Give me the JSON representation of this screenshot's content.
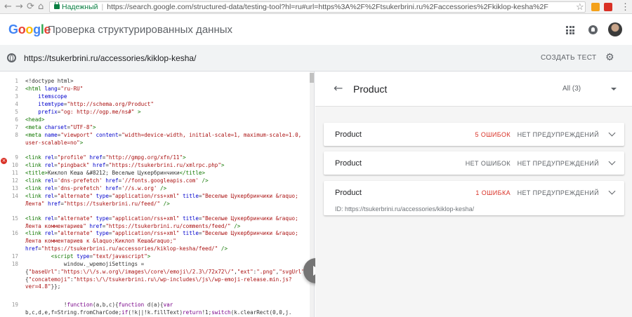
{
  "browser": {
    "back": "←",
    "forward": "→",
    "reload": "⟳",
    "home": "⌂",
    "secure_label": "Надежный",
    "url": "https://search.google.com/structured-data/testing-tool?hl=ru#url=https%3A%2F%2Ftsukerbrini.ru%2Faccessories%2Fkiklop-kesha%2F",
    "star": "☆",
    "menu": "⋮"
  },
  "app": {
    "logo_letters": [
      "G",
      "o",
      "o",
      "g",
      "l",
      "e"
    ],
    "logo_colors": [
      "#4285f4",
      "#ea4335",
      "#fbbc05",
      "#4285f4",
      "#34a853",
      "#ea4335"
    ],
    "title": "Проверка структурированных данных"
  },
  "urlbar": {
    "tested_url": "https://tsukerbrini.ru/accessories/kiklop-kesha/",
    "create_test": "СОЗДАТЬ ТЕСТ",
    "settings_glyph": "⚙"
  },
  "code": {
    "error_glyph": "×",
    "lines": [
      {
        "n": "1",
        "html": "&lt;!doctype html&gt;"
      },
      {
        "n": "2",
        "html": "<span class='t'>&lt;html</span> <span class='a'>lang</span>=<span class='s'>\"ru-RU\"</span>"
      },
      {
        "n": "3",
        "html": "    <span class='a'>itemscope</span>"
      },
      {
        "n": "4",
        "html": "    <span class='a'>itemtype</span>=<span class='s'>\"http://schema.org/Product\"</span>"
      },
      {
        "n": "5",
        "html": "    <span class='a'>prefix</span>=<span class='s'>\"og: http://ogp.me/ns#\"</span> <span class='t'>&gt;</span>"
      },
      {
        "n": "6",
        "html": "<span class='t'>&lt;head&gt;</span>"
      },
      {
        "n": "7",
        "html": "<span class='t'>&lt;meta</span> <span class='a'>charset</span>=<span class='s'>\"UTF-8\"</span><span class='t'>&gt;</span>"
      },
      {
        "n": "8",
        "html": "<span class='t'>&lt;meta</span> <span class='a'>name</span>=<span class='s'>\"viewport\"</span> <span class='a'>content</span>=<span class='s'>\"width=device-width, initial-scale=1, maximum-scale=1.0, user-scalable=no\"</span><span class='t'>&gt;</span>"
      },
      {
        "n": "9",
        "html": "<span class='t'>&lt;link</span> <span class='a'>rel</span>=<span class='s'>\"profile\"</span> <span class='a'>href</span>=<span class='s'>\"http://gmpg.org/xfn/11\"</span><span class='t'>&gt;</span>"
      },
      {
        "n": "10",
        "html": "<span class='t'>&lt;link</span> <span class='a'>rel</span>=<span class='s'>\"pingback\"</span> <span class='a'>href</span>=<span class='s'>\"https://tsukerbrini.ru/xmlrpc.php\"</span><span class='t'>&gt;</span>"
      },
      {
        "n": "11",
        "html": "<span class='t'>&lt;title&gt;</span>Киклоп Кеша &amp;#8212; Веселые Цукербринчики<span class='t'>&lt;/title&gt;</span>"
      },
      {
        "n": "12",
        "html": "<span class='t'>&lt;link</span> <span class='a'>rel</span>=<span class='s'>'dns-prefetch'</span> <span class='a'>href</span>=<span class='s'>'//fonts.googleapis.com'</span> <span class='t'>/&gt;</span>"
      },
      {
        "n": "13",
        "html": "<span class='t'>&lt;link</span> <span class='a'>rel</span>=<span class='s'>'dns-prefetch'</span> <span class='a'>href</span>=<span class='s'>'//s.w.org'</span> <span class='t'>/&gt;</span>"
      },
      {
        "n": "14",
        "html": "<span class='t'>&lt;link</span> <span class='a'>rel</span>=<span class='s'>\"alternate\"</span> <span class='a'>type</span>=<span class='s'>\"application/rss+xml\"</span> <span class='a'>title</span>=<span class='s'>\"Веселые Цукербринчики &amp;raquo; Лента\"</span> <span class='a'>href</span>=<span class='s'>\"https://tsukerbrini.ru/feed/\"</span> <span class='t'>/&gt;</span>"
      },
      {
        "n": "15",
        "html": "<span class='t'>&lt;link</span> <span class='a'>rel</span>=<span class='s'>\"alternate\"</span> <span class='a'>type</span>=<span class='s'>\"application/rss+xml\"</span> <span class='a'>title</span>=<span class='s'>\"Веселые Цукербринчики &amp;raquo; Лента комментариев\"</span> <span class='a'>href</span>=<span class='s'>\"https://tsukerbrini.ru/comments/feed/\"</span> <span class='t'>/&gt;</span>"
      },
      {
        "n": "16",
        "html": "<span class='t'>&lt;link</span> <span class='a'>rel</span>=<span class='s'>\"alternate\"</span> <span class='a'>type</span>=<span class='s'>\"application/rss+xml\"</span> <span class='a'>title</span>=<span class='s'>\"Веселые Цукербринчики &amp;raquo; Лента комментариев к &amp;laquo;Киклоп Кеша&amp;raquo;\"</span> <span class='a'>href</span>=<span class='s'>\"https://tsukerbrini.ru/accessories/kiklop-kesha/feed/\"</span> <span class='t'>/&gt;</span>"
      },
      {
        "n": "17",
        "html": "        <span class='t'>&lt;script</span> <span class='a'>type</span>=<span class='s'>\"text/javascript\"</span><span class='t'>&gt;</span>"
      },
      {
        "n": "18",
        "html": "            window._wpemojiSettings = {<span class='s'>\"baseUrl\"</span>:<span class='s'>\"https:\\/\\/s.w.org\\/images\\/core\\/emoji\\/2.3\\/72x72\\/\"</span>,<span class='s'>\"ext\"</span>:<span class='s'>\".png\"</span>,<span class='s'>\"svgUrl\"</span>:<span class='s'>\"https:\\/\\/s.w.org\\/images\\/core\\/emoji\\/2.3\\/svg\\/\"</span>,<span class='s'>\"svgExt\"</span>:<span class='s'>\".svg\"</span>,<span class='s'>\"source\"</span>:{<span class='s'>\"concatemoji\"</span>:<span class='s'>\"https:\\/\\/tsukerbrini.ru\\/wp-includes\\/js\\/wp-emoji-release.min.js?ver=4.8\"</span>}};"
      },
      {
        "n": "19",
        "html": "            !<span class='k'>function</span>(a,b,c){<span class='k'>function</span> d(a){<span class='k'>var</span> b,c,d,e,f=String.fromCharCode;<span class='k'>if</span>(!k||!k.fillText)<span class='k'>return</span>!1;<span class='k'>switch</span>(k.clearRect(0,0,j.</span>"
      }
    ]
  },
  "results": {
    "back_glyph": "←",
    "title": "Product",
    "filter": "All (3)",
    "cards": [
      {
        "name": "Product",
        "errors": "5 ОШИБОК",
        "errors_color": "#d93025",
        "warnings": "НЕТ ПРЕДУПРЕЖДЕНИЙ",
        "id": ""
      },
      {
        "name": "Product",
        "errors": "НЕТ ОШИБОК",
        "errors_color": "#5f6368",
        "warnings": "НЕТ ПРЕДУПРЕЖДЕНИЙ",
        "id": ""
      },
      {
        "name": "Product",
        "errors": "1 ОШИБКА",
        "errors_color": "#d93025",
        "warnings": "НЕТ ПРЕДУПРЕЖДЕНИЙ",
        "id": "ID: https://tsukerbrini.ru/accessories/kiklop-kesha/"
      }
    ]
  }
}
